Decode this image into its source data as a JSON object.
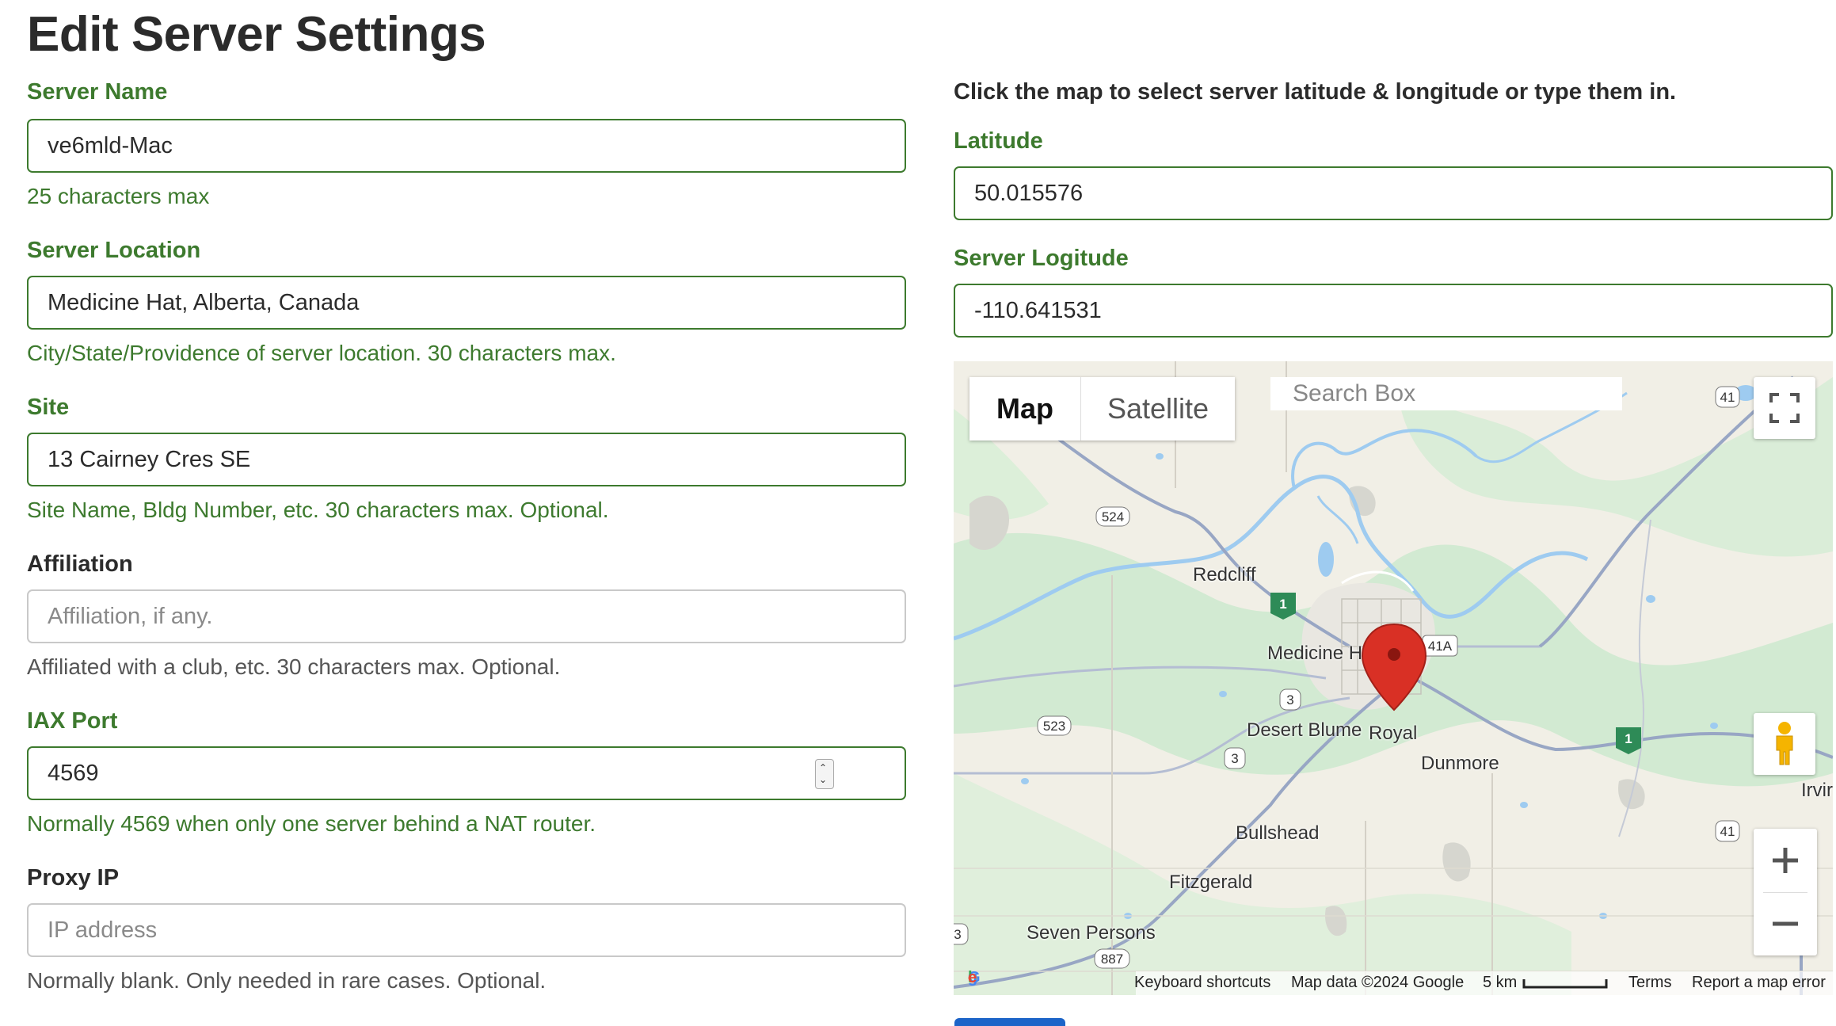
{
  "page": {
    "title": "Edit Server Settings"
  },
  "form": {
    "server_name": {
      "label": "Server Name",
      "value": "ve6mld-Mac",
      "help": "25 characters max"
    },
    "server_location": {
      "label": "Server Location",
      "value": "Medicine Hat, Alberta, Canada",
      "help": "City/State/Providence of server location. 30 characters max."
    },
    "site": {
      "label": "Site",
      "value": "13 Cairney Cres SE",
      "help": "Site Name, Bldg Number, etc. 30 characters max. Optional."
    },
    "affiliation": {
      "label": "Affiliation",
      "value": "",
      "placeholder": "Affiliation, if any.",
      "help": "Affiliated with a club, etc. 30 characters max. Optional."
    },
    "iax_port": {
      "label": "IAX Port",
      "value": "4569",
      "help": "Normally 4569 when only one server behind a NAT router."
    },
    "proxy_ip": {
      "label": "Proxy IP",
      "value": "",
      "placeholder": "IP address",
      "help": "Normally blank. Only needed in rare cases. Optional."
    }
  },
  "location": {
    "instruction": "Click the map to select server latitude & longitude or type them in.",
    "latitude": {
      "label": "Latitude",
      "value": "50.015576"
    },
    "longitude": {
      "label": "Server Logitude",
      "value": "-110.641531"
    }
  },
  "map": {
    "type_map": "Map",
    "type_satellite": "Satellite",
    "search_placeholder": "Search Box",
    "places": {
      "redcliff": "Redcliff",
      "medicine_hat": "Medicine Hat",
      "desert_blume": "Desert Blume",
      "royal": "Royal",
      "dunmore": "Dunmore",
      "bullshead": "Bullshead",
      "fitzgerald": "Fitzgerald",
      "seven_persons": "Seven Persons",
      "irvine": "Irvir"
    },
    "shields": {
      "h524": "524",
      "h523": "523",
      "h41a": "41A",
      "h41_top": "41",
      "h41_bottom": "41",
      "h3_a": "3",
      "h3_b": "3",
      "h3_edge": "3",
      "h887": "887",
      "h1_a": "1",
      "h1_b": "1"
    },
    "footer": {
      "logo": "Google",
      "keyboard": "Keyboard shortcuts",
      "mapdata": "Map data ©2024 Google",
      "scale": "5 km",
      "terms": "Terms",
      "report": "Report a map error"
    },
    "colors": {
      "land": "#f1efe6",
      "green": "#d2ead2",
      "water": "#9ecbf0",
      "road": "#98a6c4",
      "marker": "#d93025"
    }
  }
}
